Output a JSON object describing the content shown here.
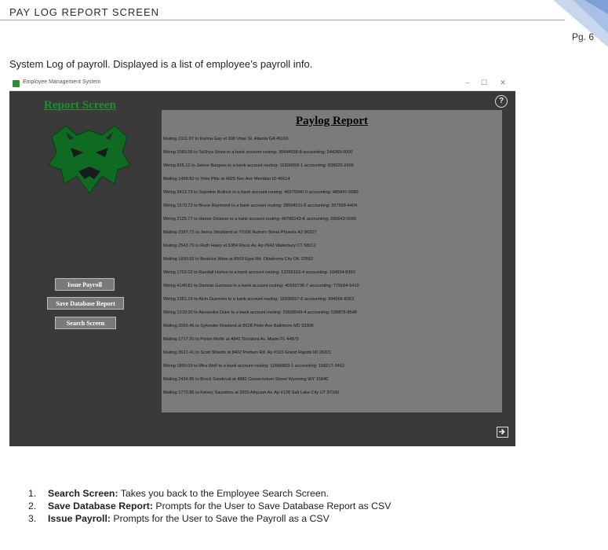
{
  "document": {
    "header": "PAY LOG REPORT SCREEN",
    "page_number": "Pg. 6",
    "description": "System Log of payroll. Displayed is a list of employee’s payroll info."
  },
  "window": {
    "title": "Employee Management System",
    "controls": [
      "–",
      "☐",
      "✕"
    ]
  },
  "app": {
    "report_screen_title": "Report Screen",
    "help_icon_glyph": "?",
    "buttons": {
      "issue_payroll": "Issue Payroll",
      "save_database_report": "Save Database Report",
      "search_screen": "Search Screen"
    },
    "paylog": {
      "heading": "Paylog Report",
      "entries": [
        "Mailing 1911.87 to Karina Gay at 998 Vitae St. Atlanta GA 45169",
        "Wiring 2083.56 to TaShya Snow to a bank account routing: 36644938-8 accounting: 244269-0000",
        "Wiring 835.12 to Jolene Burgess to a bank account routing: 15300058-1 accounting: 828625-2906",
        "Mailing 1468.83 to Yoko Pitts at 4825 Nec Ave Meridian ID 45614",
        "Wiring 3413.73 to Sopoline Bullock to a bank account routing: 46979340-0 accounting: 485847-0083",
        "Wiring 1570.72 to Bruce Raymond to a bank account routing: 28504011-6 accounting: 397558-4404",
        "Wiring 2125.77 to Hanae Dickson to a bank account routing: 48786143-K accounting: 295643-0090",
        "Mailing 2397.72 to Jenna Strickland at 70156 Rutrum Street Phoenix AZ 86207",
        "Mailing 2543.76 to Ruth Haley at 6384 Risus Av. Ap #943 Waterbury CT 58012",
        "Mailing 1930.92 to Beatrice Ware at 8903 Eget Rd. Oklahoma City OK 20552",
        "Wiring 1703.02 to Randall Horton to a bank account routing: 13255163-4 accounting: 104934-8350",
        "Wiring 4148.81 to Damian Garrison to a bank account routing: 45550736-7 accounting: 779184-5410",
        "Wiring 2351.29 to Alvin Guerrero to a bank account routing: 16935557-6 accounting: 994966-8363",
        "Wiring 1318.00 to Alexandra Duke to a bank account routing: 23609043-4 accounting: 538878-8548",
        "Mailing 2065.46 to Sylvester Rowland at 8628 Pede Ave Baltimore MD 93306",
        "Mailing 1717.20 to Porter Wolfe at 4842 Tincidunt Av. Miami FL 44875",
        "Mailing 3621.41 to Scott Shields at 8402 Pretium Rd. Ap #163 Grand Rapids MI 26321",
        "Wiring 1899.03 to Mira Wolf to a bank account routing: 12666803-1 accounting: 158217-3462",
        "Mailing 2434.86 to Brock Sandoval at 4882 Consectetuer Street Wyoming WY 15840",
        "Mailing 1772.86 to Kelsey Saunders at 9920 Aliquam Av. Ap #128 Salt Lake City UT 97100"
      ]
    }
  },
  "footer_list": [
    {
      "num": "1.",
      "term": "Search Screen:",
      "text": " Takes you back to the Employee Search Screen."
    },
    {
      "num": "2.",
      "term": "Save Database Report:",
      "text": " Prompts for the User to Save Database Report as CSV"
    },
    {
      "num": "3.",
      "term": "Issue Payroll:",
      "text": " Prompts for the User to Save the Payroll as a CSV"
    }
  ],
  "colors": {
    "accent_green": "#1e8f2e",
    "window_background": "#3a3a3a",
    "report_panel": "#7b7b7b",
    "header_rule": "#8eaadb"
  }
}
